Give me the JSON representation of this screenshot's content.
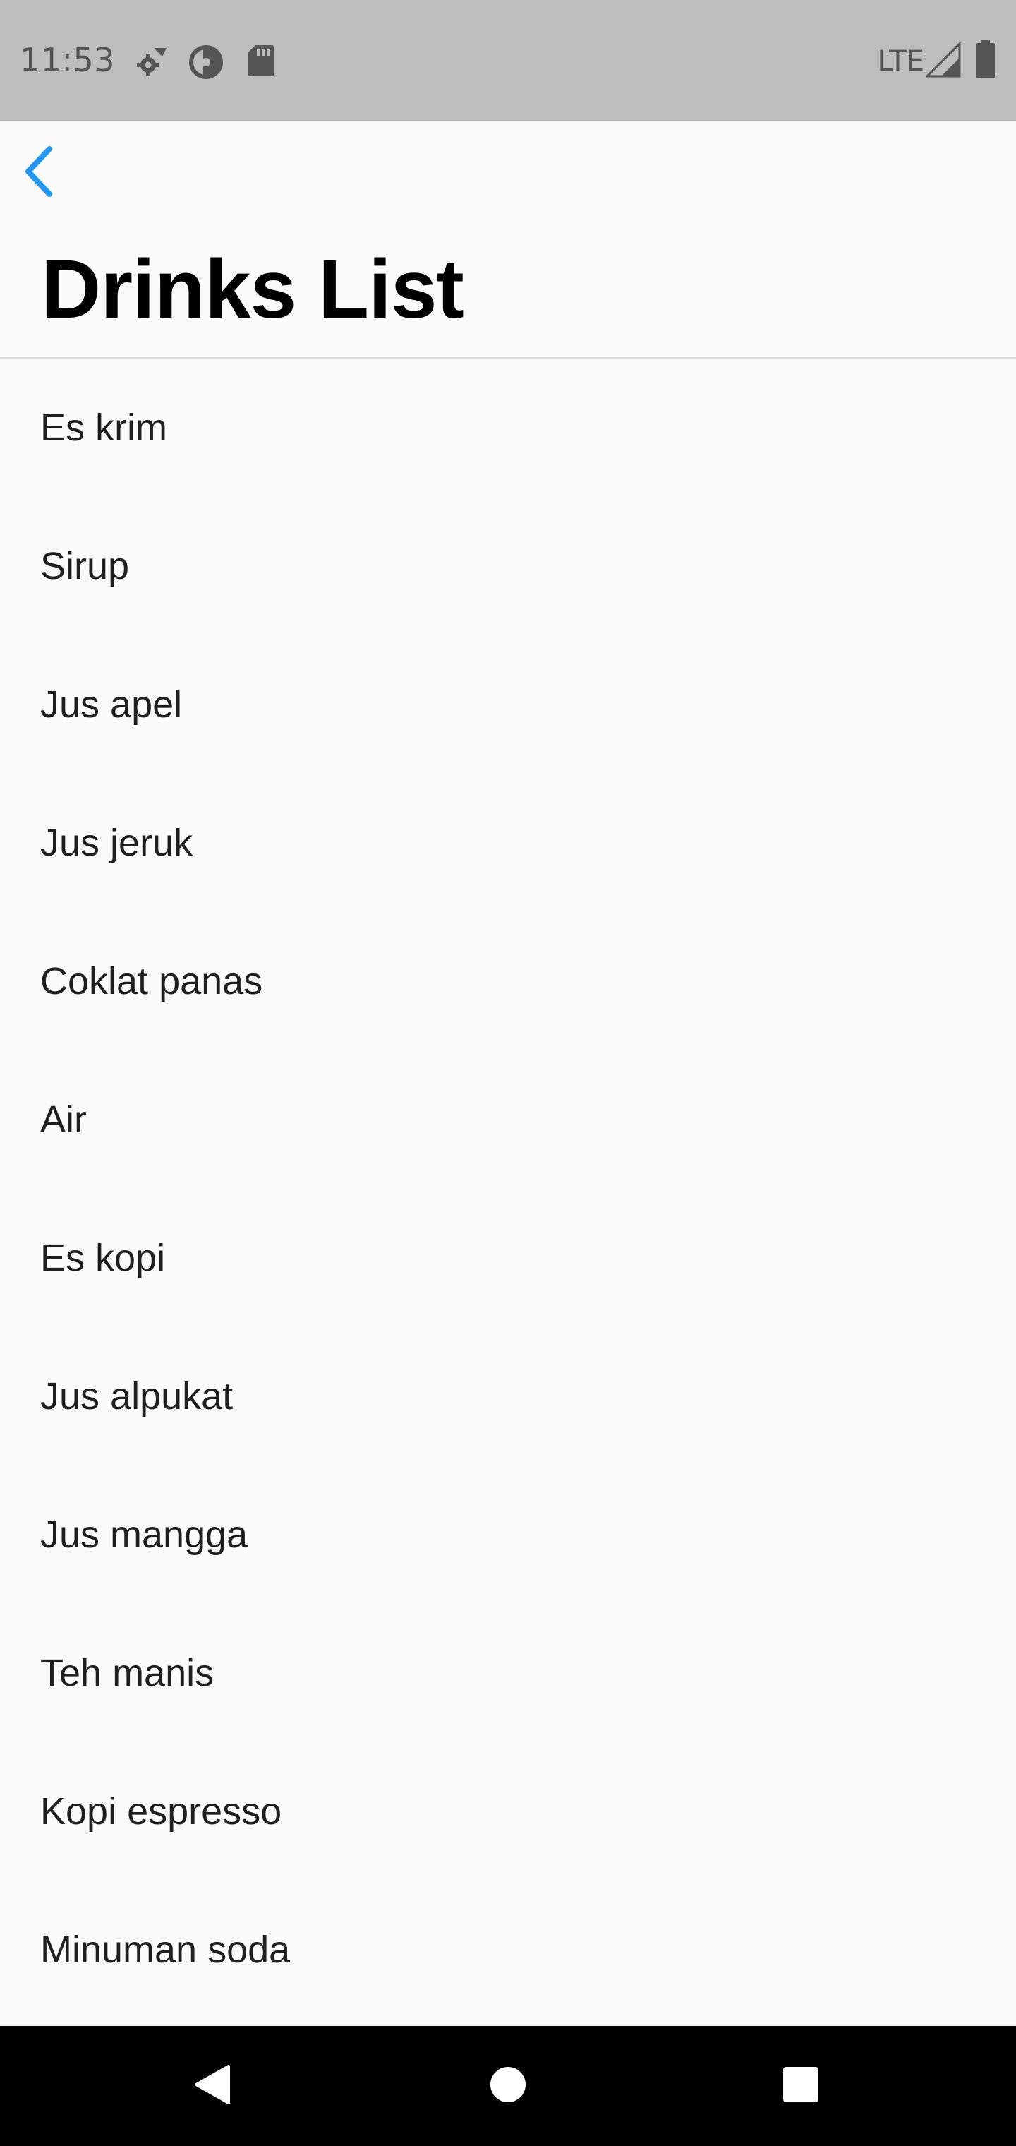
{
  "status_bar": {
    "time": "11:53",
    "network": "LTE",
    "icons": [
      "settings-sync-icon",
      "data-saver-icon",
      "sd-card-icon",
      "signal-icon",
      "battery-icon"
    ]
  },
  "header": {
    "back_icon": "chevron-left-icon",
    "title": "Drinks List"
  },
  "drinks": [
    "Es krim",
    "Sirup",
    "Jus apel",
    "Jus jeruk",
    "Coklat panas",
    "Air",
    "Es kopi",
    "Jus alpukat",
    "Jus mangga",
    "Teh manis",
    "Kopi espresso",
    "Minuman soda"
  ],
  "nav_bar": {
    "icons": [
      "back-triangle-icon",
      "home-circle-icon",
      "recents-square-icon"
    ]
  },
  "colors": {
    "status_bar_bg": "#bdbdbd",
    "page_bg": "#fafafa",
    "accent": "#2196f3",
    "nav_bar_bg": "#000000"
  }
}
